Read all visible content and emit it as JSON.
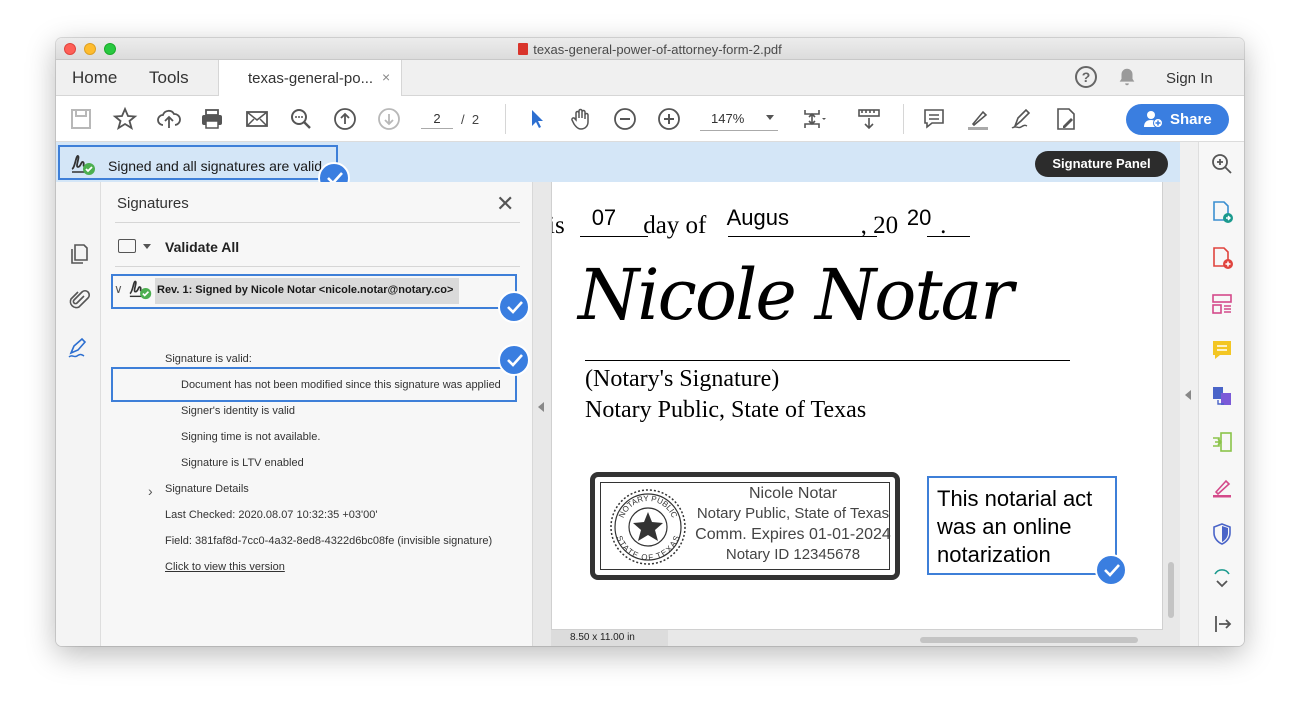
{
  "window": {
    "title": "texas-general-power-of-attorney-form-2.pdf"
  },
  "tabs": {
    "home": "Home",
    "tools": "Tools",
    "doc_tab": "texas-general-po...",
    "doc_tab_close": "×",
    "signin": "Sign In",
    "help": "?"
  },
  "toolbar": {
    "page_current": "2",
    "page_sep": "/",
    "page_total": "2",
    "zoom": "147%",
    "share_label": "Share"
  },
  "sigbar": {
    "status": "Signed and all signatures are valid",
    "panel_button": "Signature Panel"
  },
  "panel": {
    "title": "Signatures",
    "close": "✕",
    "validate_all": "Validate All",
    "rev_label": "Rev. 1: Signed by Nicole Notar <nicole.notar@notary.co>",
    "valid": "Signature is valid:",
    "not_modified": "Document has not been modified since this signature was applied",
    "identity": "Signer's identity is valid",
    "signing_time": "Signing time is not available.",
    "ltv": "Signature is LTV enabled",
    "details": "Signature Details",
    "last_checked": "Last Checked: 2020.08.07 10:32:35 +03'00'",
    "field": "Field: 381faf8d-7cc0-4a32-8ed8-4322d6bc08fe (invisible signature)",
    "view_version": "Click to view this version"
  },
  "document": {
    "text_this": "is",
    "day_value": "07",
    "text_day_of": "day of",
    "month_value": "Augus",
    "text_comma_20": ", 20",
    "year_value": "20",
    "text_period": ".",
    "signature": "Nicole Notar",
    "notary_sig_label": "(Notary's Signature)",
    "notary_public_label": "Notary Public, State of Texas",
    "seal": {
      "name": "Nicole Notar",
      "title": "Notary Public, State of Texas",
      "expires": "Comm. Expires 01-01-2024",
      "id": "Notary ID 12345678",
      "ring_top": "NOTARY PUBLIC",
      "ring_bottom": "STATE OF TEXAS"
    },
    "note_line1": "This notarial act",
    "note_line2": "was an online",
    "note_line3": "notarization",
    "page_size": "8.50 x 11.00 in"
  },
  "colors": {
    "accent": "#3a7ee0",
    "banner": "#d4e6f7",
    "valid_green": "#4caf50"
  }
}
